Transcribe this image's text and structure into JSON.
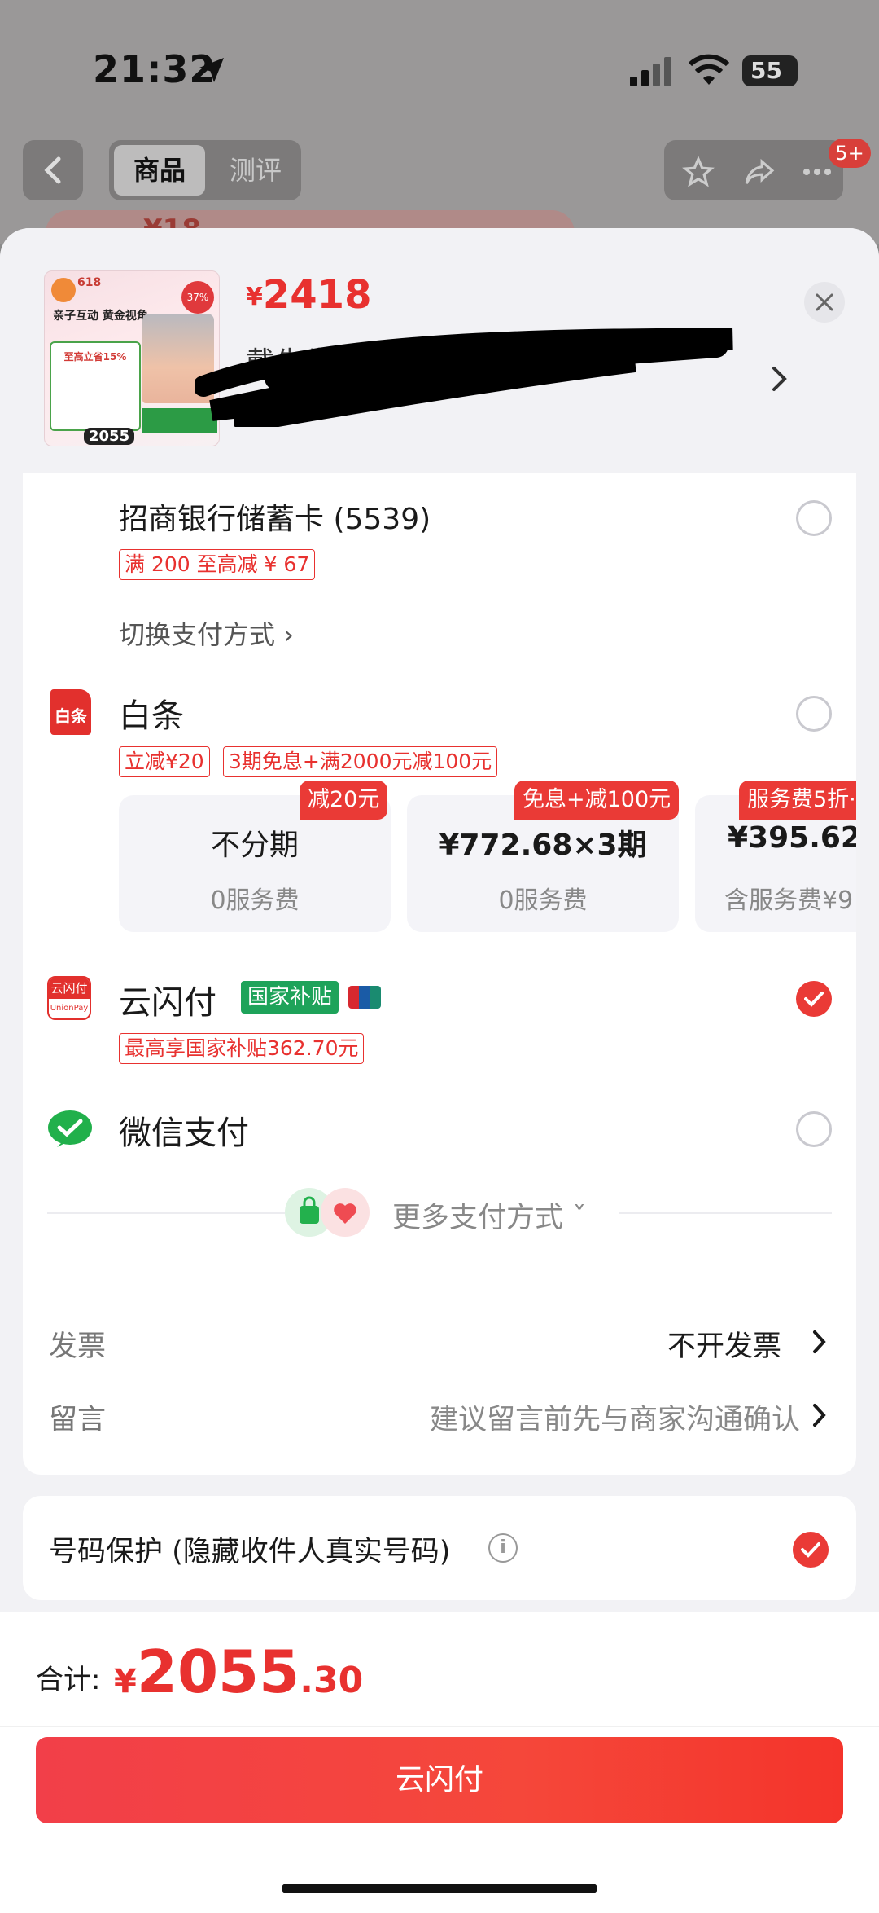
{
  "status_bar": {
    "time": "21:32",
    "battery": "55"
  },
  "nav": {
    "tab_product": "商品",
    "tab_review": "测评",
    "cart_badge": "5+",
    "peek_price": "¥18"
  },
  "product": {
    "currency": "¥",
    "price": "2418",
    "address_visible": "戴先生",
    "thumb": {
      "badge_618": "618",
      "title": "亲子互动 黄金视角",
      "discount": "37% off",
      "promo": "至高立省15%",
      "price": "2055"
    }
  },
  "payment": {
    "cmb": {
      "label": "招商银行储蓄卡 (5539)",
      "tag": "满 200 至高减 ¥ 67"
    },
    "switch_method": "切换支付方式 ›",
    "baitiao": {
      "icon_text": "白条",
      "label": "白条",
      "tags": [
        "立减¥20",
        "3期免息+满2000元减100元"
      ],
      "plans": [
        {
          "tag": "减20元",
          "main": "不分期",
          "sub": "0服务费"
        },
        {
          "tag": "免息+减100元",
          "main": "¥772.68×3期",
          "sub": "0服务费"
        },
        {
          "tag": "服务费5折·",
          "main": "¥395.62×",
          "sub": "含服务费¥9"
        }
      ]
    },
    "unionpay": {
      "icon_top": "云闪付",
      "icon_bottom": "UnionPay",
      "label": "云闪付",
      "badge": "国家补贴",
      "tag": "最高享国家补贴362.70元"
    },
    "wechat": {
      "label": "微信支付"
    },
    "more": "更多支付方式 ˇ"
  },
  "invoice": {
    "label": "发票",
    "value": "不开发票"
  },
  "note": {
    "label": "留言",
    "placeholder": "建议留言前先与商家沟通确认"
  },
  "privacy": {
    "label": "号码保护 (隐藏收件人真实号码)",
    "info_icon": "i"
  },
  "footer": {
    "total_label": "合计:",
    "currency": "¥",
    "total_int": "2055",
    "total_dec": ".30",
    "pay_button": "云闪付"
  },
  "colors": {
    "accent": "#e8312f",
    "green": "#1ea35a",
    "sheet_bg": "#f2f2f5"
  },
  "icons": [
    "location-arrow-icon",
    "signal-icon",
    "wifi-icon",
    "battery-icon",
    "back-icon",
    "star-icon",
    "share-icon",
    "more-icon",
    "close-icon",
    "chevron-right-icon",
    "baitiao-icon",
    "unionpay-icon",
    "wechat-pay-icon",
    "check-icon",
    "info-icon",
    "shopping-bag-icon",
    "heart-pay-icon"
  ]
}
